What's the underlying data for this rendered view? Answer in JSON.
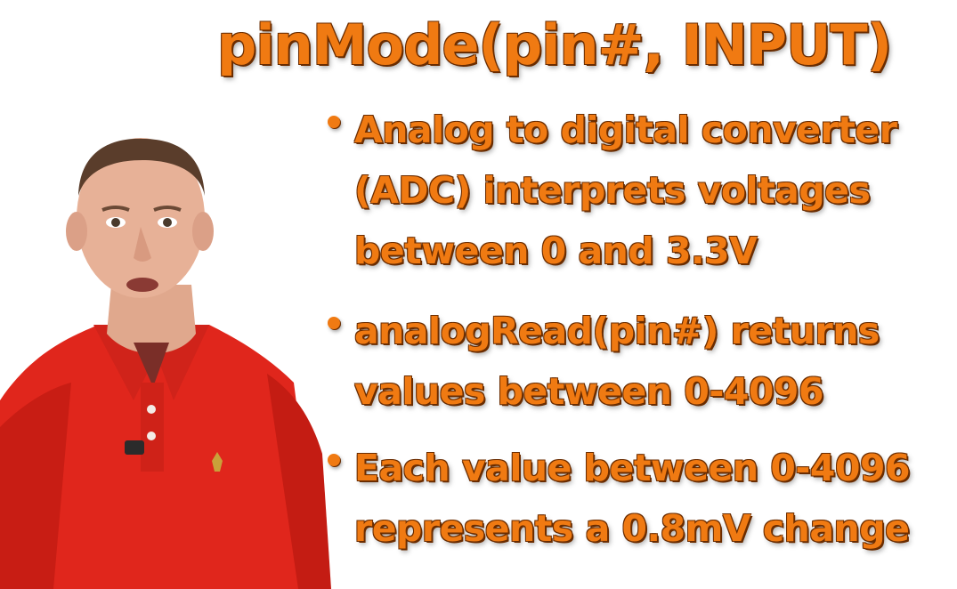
{
  "slide": {
    "title": "pinMode(pin#, INPUT)",
    "bullets": [
      {
        "lines": [
          "Analog to digital converter",
          "(ADC) interprets voltages",
          "between 0 and 3.3V"
        ]
      },
      {
        "lines": [
          "analogRead(pin#) returns",
          "values between 0-4096"
        ]
      },
      {
        "lines": [
          "Each value between 0-4096",
          "represents a 0.8mV change"
        ]
      }
    ]
  },
  "colors": {
    "text": "#f07a12",
    "text_outline": "#6a2c00",
    "background": "#ffffff",
    "shirt": "#e0261c"
  }
}
